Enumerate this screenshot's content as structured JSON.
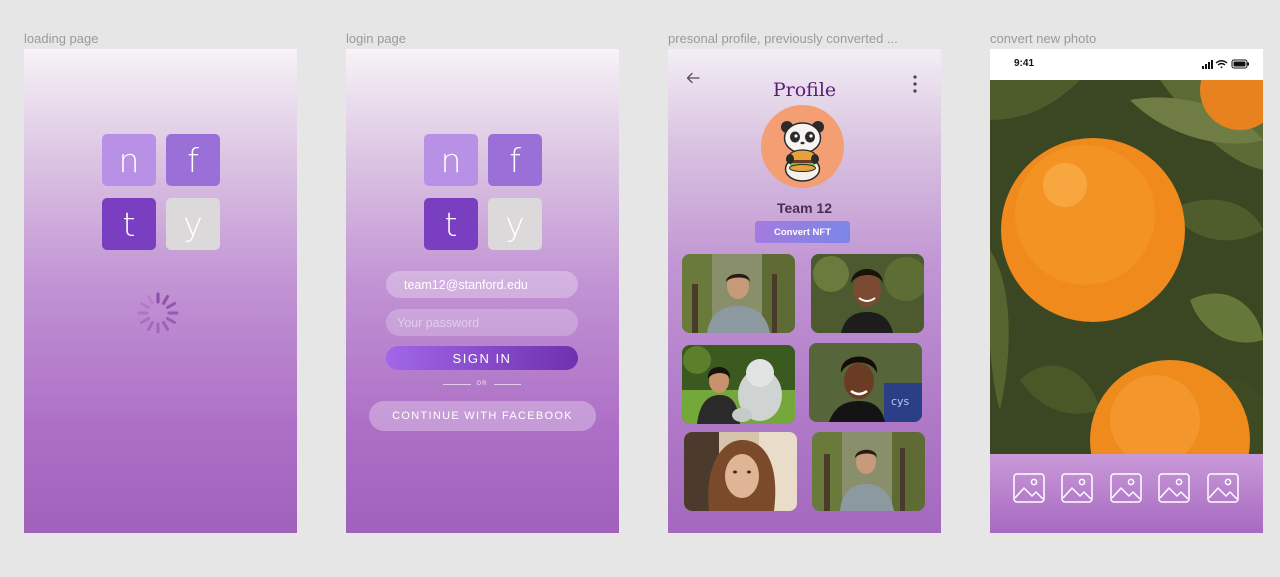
{
  "frames": {
    "loading": {
      "label": "loading page"
    },
    "login": {
      "label": "login page"
    },
    "profile": {
      "label": "presonal profile, previously converted ..."
    },
    "convert": {
      "label": "convert new photo"
    }
  },
  "logo": {
    "n": "n",
    "f": "f",
    "t": "t",
    "y": "y"
  },
  "login": {
    "email_value": "team12@stanford.edu",
    "password_placeholder": "Your password",
    "signin_label": "SIGN IN",
    "or_label": "OR",
    "facebook_label": "CONTINUE WITH FACEBOOK"
  },
  "profile": {
    "title": "Profile",
    "name": "Team 12",
    "convert_label": "Convert NFT",
    "avatar_icon": "panda-burger-avatar",
    "photos_count": 6
  },
  "convert": {
    "time": "9:41",
    "gallery_icon": "image-icon"
  },
  "colors": {
    "accent": "#7a3ec0",
    "title": "#5b1d75",
    "avatar_bg": "#f49e73"
  }
}
